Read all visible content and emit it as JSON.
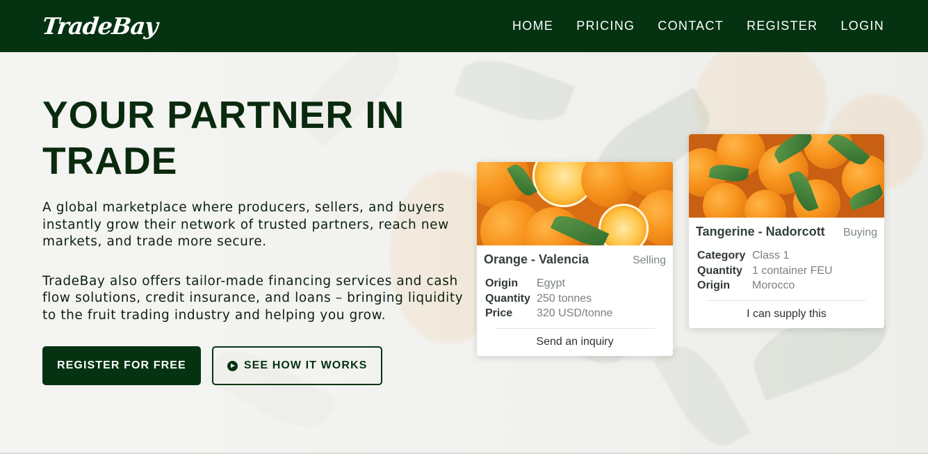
{
  "header": {
    "logo": "TradeBay",
    "nav": [
      "HOME",
      "PRICING",
      "CONTACT",
      "REGISTER",
      "LOGIN"
    ]
  },
  "hero": {
    "title": "YOUR PARTNER IN TRADE",
    "paragraph1": "A global marketplace where producers, sellers, and buyers instantly grow their network of trusted partners, reach new markets, and trade more secure.",
    "paragraph2": "TradeBay also offers tailor-made financing services and cash flow solutions, credit insurance, and loans – bringing liquidity to the fruit trading industry and helping you grow.",
    "cta_primary": "REGISTER FOR FREE",
    "cta_secondary": "SEE HOW IT WORKS"
  },
  "cards": [
    {
      "title": "Orange - Valencia",
      "status": "Selling",
      "specs": [
        {
          "label": "Origin",
          "value": "Egypt"
        },
        {
          "label": "Quantity",
          "value": "250 tonnes"
        },
        {
          "label": "Price",
          "value": "320 USD/tonne"
        }
      ],
      "action": "Send an inquiry"
    },
    {
      "title": "Tangerine - Nadorcott",
      "status": "Buying",
      "specs": [
        {
          "label": "Category",
          "value": "Class 1"
        },
        {
          "label": "Quantity",
          "value": "1 container FEU"
        },
        {
          "label": "Origin",
          "value": "Morocco"
        }
      ],
      "action": "I can supply this"
    }
  ],
  "colors": {
    "brand_dark_green": "#053312",
    "heading_green": "#0a2a0e",
    "card_status_gray": "#7d8a80"
  },
  "icons": {
    "play": "play-circle-icon"
  }
}
